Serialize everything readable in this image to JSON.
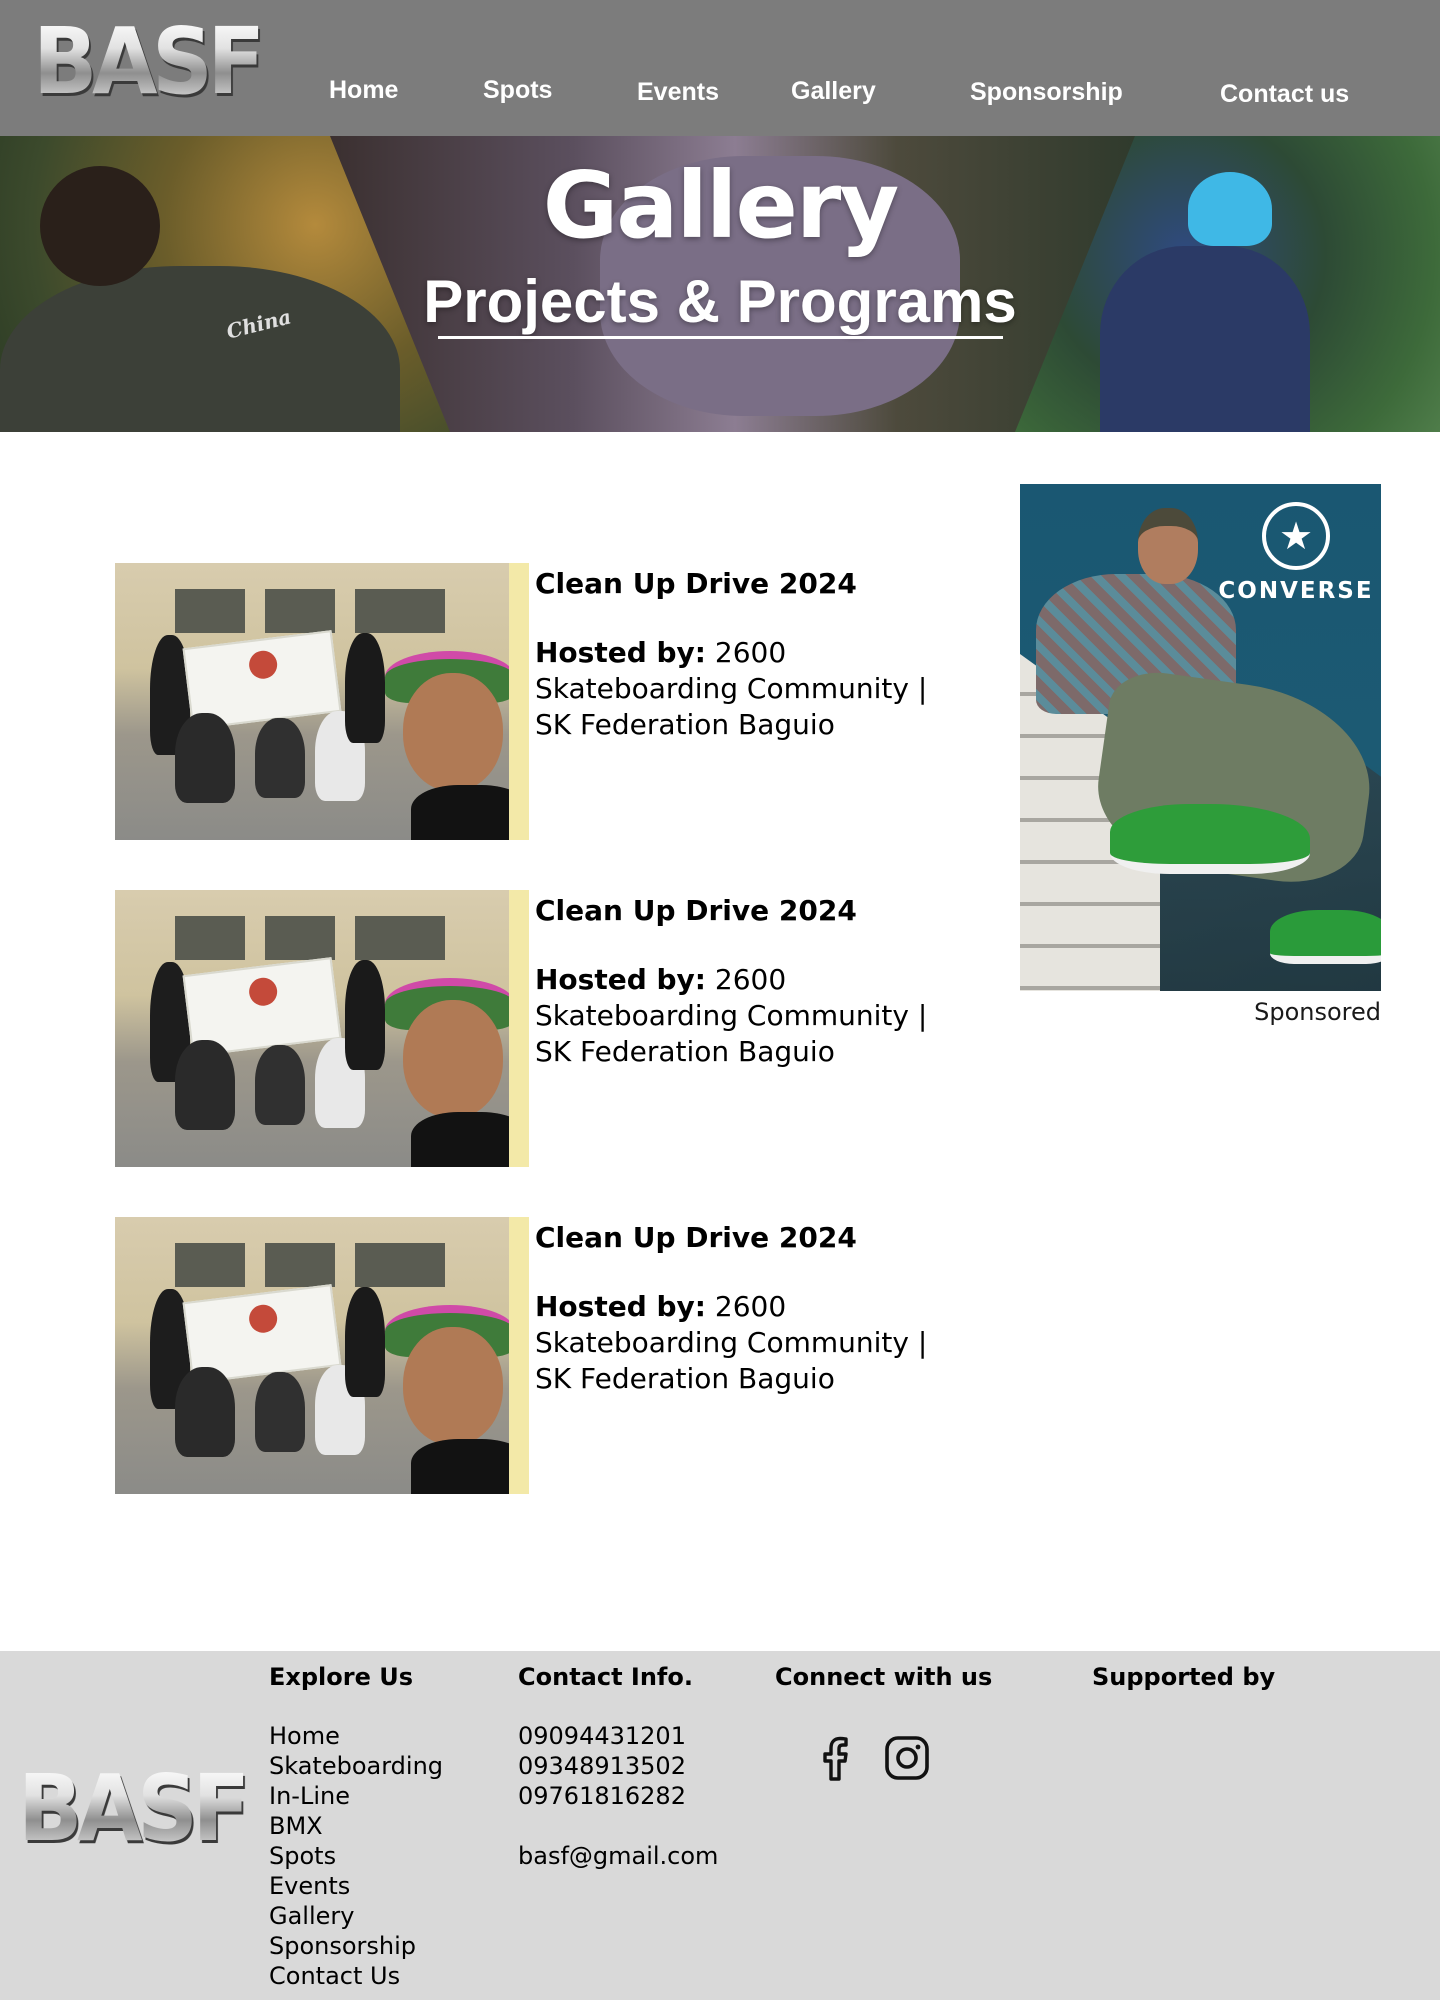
{
  "brand": {
    "logo_text": "BASF"
  },
  "nav": {
    "items": [
      {
        "label": "Home"
      },
      {
        "label": "Spots"
      },
      {
        "label": "Events"
      },
      {
        "label": "Gallery"
      },
      {
        "label": "Sponsorship"
      },
      {
        "label": "Contact us"
      }
    ]
  },
  "hero": {
    "title": "Gallery",
    "subtitle": "Projects & Programs",
    "shirt_text": "China"
  },
  "events": [
    {
      "title": "Clean Up Drive 2024",
      "host_label": "Hosted by:",
      "host_value": " 2600 Skateboarding Community | SK Federation Baguio"
    },
    {
      "title": "Clean Up Drive 2024",
      "host_label": "Hosted by:",
      "host_value": " 2600 Skateboarding Community | SK Federation Baguio"
    },
    {
      "title": "Clean Up Drive 2024",
      "host_label": "Hosted by:",
      "host_value": " 2600 Skateboarding Community | SK Federation Baguio"
    }
  ],
  "sponsor": {
    "brand_text": "CONVERSE",
    "label": "Sponsored"
  },
  "footer": {
    "logo_text": "BASF",
    "explore": {
      "heading": "Explore Us",
      "links": [
        "Home",
        "Skateboarding",
        "In-Line",
        "BMX",
        "Spots",
        "Events",
        "Gallery",
        "Sponsorship",
        "Contact Us"
      ]
    },
    "contact": {
      "heading": "Contact Info.",
      "phones": [
        "09094431201",
        "09348913502",
        "09761816282"
      ],
      "email": "basf@gmail.com"
    },
    "connect": {
      "heading": "Connect with us",
      "icons": [
        "facebook-icon",
        "instagram-icon"
      ]
    },
    "supported": {
      "heading": "Supported by"
    }
  },
  "colors": {
    "navbar": "#7c7c7c",
    "footer": "#d9d9d9",
    "sponsor_bg": "#1a5772"
  }
}
